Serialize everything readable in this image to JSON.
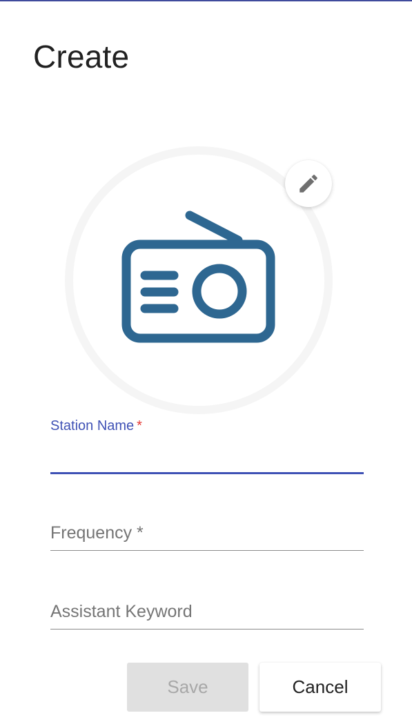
{
  "dialog": {
    "title": "Create"
  },
  "avatar": {
    "icon": "radio-icon",
    "icon_color": "#2e6791",
    "edit_icon": "pencil-icon",
    "edit_icon_color": "#6f6f6f"
  },
  "form": {
    "station_name": {
      "label": "Station Name",
      "required_marker": "*",
      "value": "",
      "focused": true
    },
    "frequency": {
      "label": "Frequency *",
      "value": ""
    },
    "assistant_keyword": {
      "label": "Assistant Keyword",
      "value": ""
    }
  },
  "actions": {
    "save_label": "Save",
    "save_disabled": true,
    "cancel_label": "Cancel"
  },
  "colors": {
    "accent": "#3f51b5",
    "required": "#e53935",
    "icon": "#2e6791"
  }
}
